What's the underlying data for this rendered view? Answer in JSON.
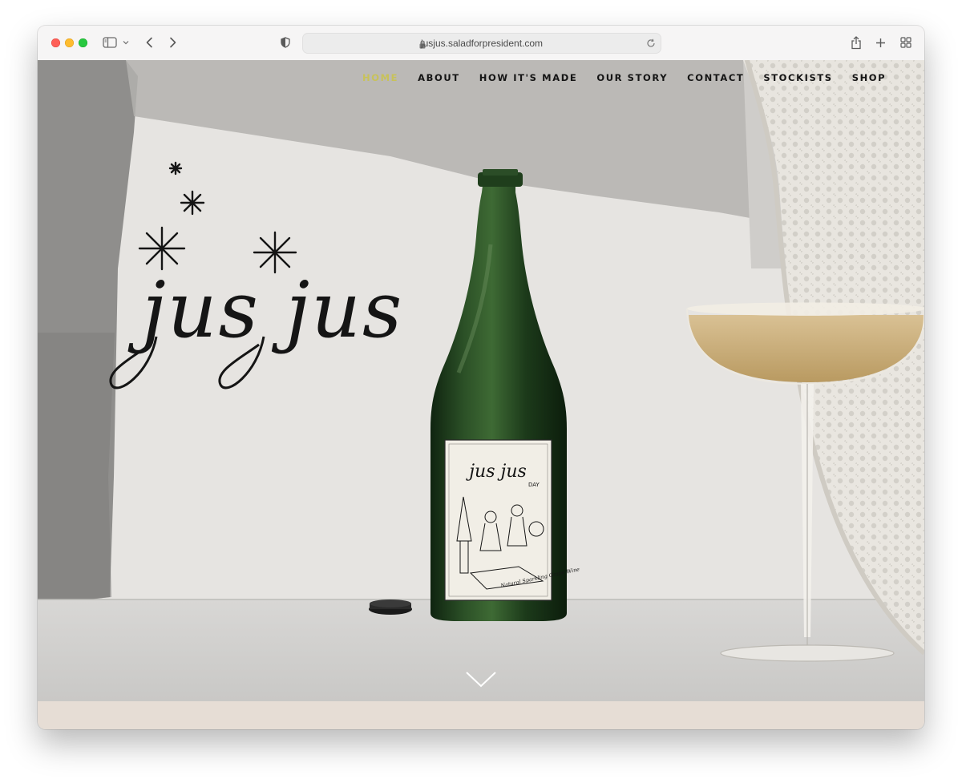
{
  "browser": {
    "url": "jusjus.saladforpresident.com",
    "icons": [
      "sidebar-icon",
      "chevron-down-icon",
      "back-icon",
      "forward-icon",
      "shield-icon",
      "lock-icon",
      "reload-icon",
      "share-icon",
      "new-tab-icon",
      "tab-overview-icon"
    ]
  },
  "nav": {
    "items": [
      {
        "label": "HOME",
        "active": true
      },
      {
        "label": "ABOUT",
        "active": false
      },
      {
        "label": "HOW IT'S MADE",
        "active": false
      },
      {
        "label": "OUR STORY",
        "active": false
      },
      {
        "label": "CONTACT",
        "active": false
      },
      {
        "label": "STOCKISTS",
        "active": false
      },
      {
        "label": "SHOP",
        "active": false
      }
    ]
  },
  "hero": {
    "logo_text": "jus jus",
    "label_logo_text": "jus jus",
    "label_sub": "DAY",
    "label_note": "Natural Sparkling Grape Wine",
    "scroll_icon": "chevron-down-icon"
  },
  "colors": {
    "accent": "#c8c25a",
    "nav_text": "#151515",
    "footer_band": "#e6ddd5",
    "bottle": "#1f3b1c",
    "wine": "#c9ac77"
  }
}
